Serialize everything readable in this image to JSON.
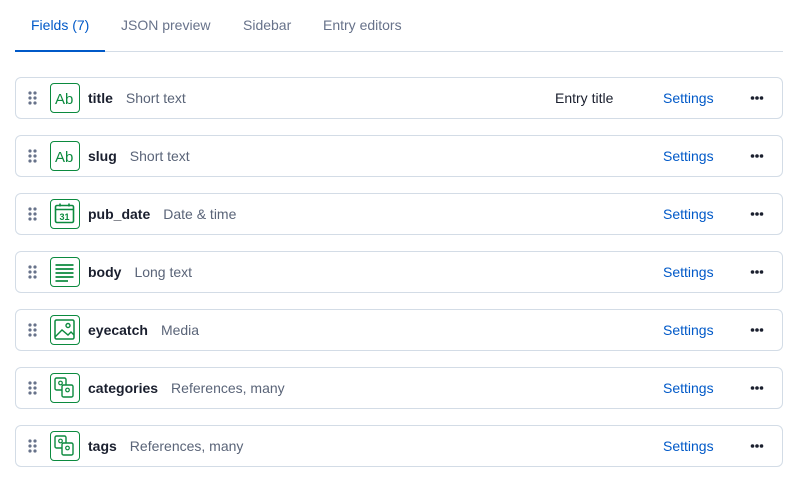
{
  "tabs": [
    {
      "label": "Fields (7)",
      "active": true
    },
    {
      "label": "JSON preview",
      "active": false
    },
    {
      "label": "Sidebar",
      "active": false
    },
    {
      "label": "Entry editors",
      "active": false
    }
  ],
  "fields": [
    {
      "name": "title",
      "type": "Short text",
      "icon": "short-text-icon",
      "entry_title_label": "Entry title",
      "settings_label": "Settings"
    },
    {
      "name": "slug",
      "type": "Short text",
      "icon": "short-text-icon",
      "settings_label": "Settings"
    },
    {
      "name": "pub_date",
      "type": "Date & time",
      "icon": "calendar-icon",
      "settings_label": "Settings"
    },
    {
      "name": "body",
      "type": "Long text",
      "icon": "long-text-icon",
      "settings_label": "Settings"
    },
    {
      "name": "eyecatch",
      "type": "Media",
      "icon": "media-icon",
      "settings_label": "Settings"
    },
    {
      "name": "categories",
      "type": "References, many",
      "icon": "references-icon",
      "settings_label": "Settings"
    },
    {
      "name": "tags",
      "type": "References, many",
      "icon": "references-icon",
      "settings_label": "Settings"
    }
  ],
  "calendar_icon_day": "31",
  "colors": {
    "accent": "#0059c8",
    "icon_green": "#0b8a3e",
    "border": "#d3dce6",
    "muted_text": "#5a6478"
  }
}
